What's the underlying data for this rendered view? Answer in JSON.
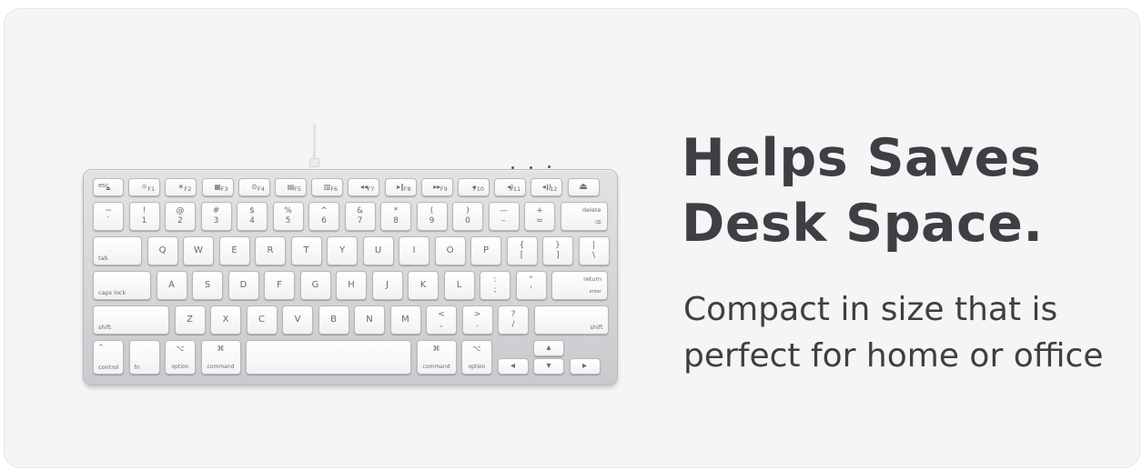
{
  "headline": {
    "line1": "Helps Saves",
    "line2": "Desk Space."
  },
  "subtext": {
    "line1": "Compact in size that is",
    "line2": "perfect for home or office"
  },
  "image": {
    "name": "compact aluminum keyboard product photo"
  },
  "keyboard": {
    "rows": [
      [
        {
          "tl": "esc",
          "bc": "⏏"
        },
        {
          "tc": "☼",
          "br": "F1"
        },
        {
          "tc": "☀",
          "br": "F2"
        },
        {
          "tc": "▦",
          "br": "F3"
        },
        {
          "tc": "⊙",
          "br": "F4"
        },
        {
          "tc": "▤",
          "br": "F5"
        },
        {
          "tc": "▥",
          "br": "F6"
        },
        {
          "tc": "◂◂",
          "br": "F7"
        },
        {
          "tc": "▸‖",
          "br": "F8"
        },
        {
          "tc": "▸▸",
          "br": "F9"
        },
        {
          "tc": "◂",
          "br": "F10"
        },
        {
          "tc": "◂)",
          "br": "F11"
        },
        {
          "tc": "◂))",
          "br": "F12"
        },
        {
          "main": "⏏"
        }
      ],
      [
        {
          "top": "~",
          "bot": "`"
        },
        {
          "top": "!",
          "bot": "1"
        },
        {
          "top": "@",
          "bot": "2"
        },
        {
          "top": "#",
          "bot": "3"
        },
        {
          "top": "$",
          "bot": "4"
        },
        {
          "top": "%",
          "bot": "5"
        },
        {
          "top": "^",
          "bot": "6"
        },
        {
          "top": "&",
          "bot": "7"
        },
        {
          "top": "*",
          "bot": "8"
        },
        {
          "top": "(",
          "bot": "9"
        },
        {
          "top": ")",
          "bot": "0"
        },
        {
          "top": "—",
          "bot": "–"
        },
        {
          "top": "+",
          "bot": "="
        },
        {
          "tr": "delete",
          "brsmall": "⌫"
        }
      ],
      [
        {
          "bl": "tab"
        },
        {
          "main": "Q"
        },
        {
          "main": "W"
        },
        {
          "main": "E"
        },
        {
          "main": "R"
        },
        {
          "main": "T"
        },
        {
          "main": "Y"
        },
        {
          "main": "U"
        },
        {
          "main": "I"
        },
        {
          "main": "O"
        },
        {
          "main": "P"
        },
        {
          "top": "{",
          "bot": "["
        },
        {
          "top": "}",
          "bot": "]"
        },
        {
          "top": "|",
          "bot": "\\"
        }
      ],
      [
        {
          "bl": "caps lock"
        },
        {
          "main": "A"
        },
        {
          "main": "S"
        },
        {
          "main": "D"
        },
        {
          "main": "F"
        },
        {
          "main": "G"
        },
        {
          "main": "H"
        },
        {
          "main": "J"
        },
        {
          "main": "K"
        },
        {
          "main": "L"
        },
        {
          "top": ":",
          "bot": ";"
        },
        {
          "top": "\"",
          "bot": "'"
        },
        {
          "tr": "return",
          "brsmall": "enter"
        }
      ],
      [
        {
          "bl": "shift"
        },
        {
          "main": "Z"
        },
        {
          "main": "X"
        },
        {
          "main": "C"
        },
        {
          "main": "V"
        },
        {
          "main": "B"
        },
        {
          "main": "N"
        },
        {
          "main": "M"
        },
        {
          "top": "<",
          "bot": ","
        },
        {
          "top": ">",
          "bot": "."
        },
        {
          "top": "?",
          "bot": "/"
        },
        {
          "br": "shift"
        }
      ],
      [
        {
          "tl": "^",
          "bl": "control"
        },
        {
          "bl": "fn"
        },
        {
          "tc": "⌥",
          "bc": "option"
        },
        {
          "tc": "⌘",
          "bc": "command"
        },
        {},
        {
          "tc": "⌘",
          "bc": "command"
        },
        {
          "tc": "⌥",
          "bc": "option"
        },
        {
          "main": "◂"
        },
        {
          "main": "▴"
        },
        {
          "main": "▾"
        },
        {
          "main": "▸"
        }
      ]
    ]
  }
}
